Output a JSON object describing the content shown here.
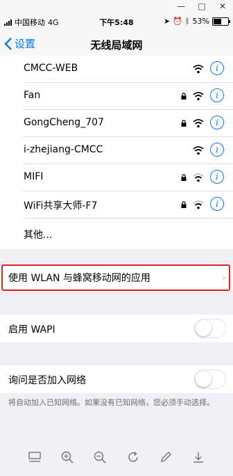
{
  "window_chrome": {
    "minimize": "—",
    "maximize": "□",
    "close": "✕"
  },
  "status_bar": {
    "carrier": "中国移动",
    "network": "4G",
    "time": "下午5:48",
    "battery_percent": "53%",
    "battery_level": 0.53
  },
  "nav": {
    "back_label": "设置",
    "title": "无线局域网"
  },
  "networks": [
    {
      "name": "CMCC-WEB",
      "locked": false
    },
    {
      "name": "Fan",
      "locked": true
    },
    {
      "name": "GongCheng_707",
      "locked": true
    },
    {
      "name": "i-zhejiang-CMCC",
      "locked": false
    },
    {
      "name": "MIFI",
      "locked": true
    },
    {
      "name": "WiFi共享大师-F7",
      "locked": true
    }
  ],
  "other_label": "其他...",
  "apps_row": {
    "label": "使用 WLAN 与蜂窝移动网的应用"
  },
  "wapi_row": {
    "label": "启用 WAPI",
    "enabled": false
  },
  "ask_row": {
    "label": "询问是否加入网络",
    "enabled": false
  },
  "footnote": "将自动加入已知网络。如果没有已知网络，您必须手动选择。",
  "colors": {
    "accent": "#007aff",
    "highlight": "#e02020"
  },
  "toolbar_icons": [
    "layout-icon",
    "zoom-in-icon",
    "zoom-out-icon",
    "rotate-icon",
    "edit-icon",
    "download-icon"
  ]
}
